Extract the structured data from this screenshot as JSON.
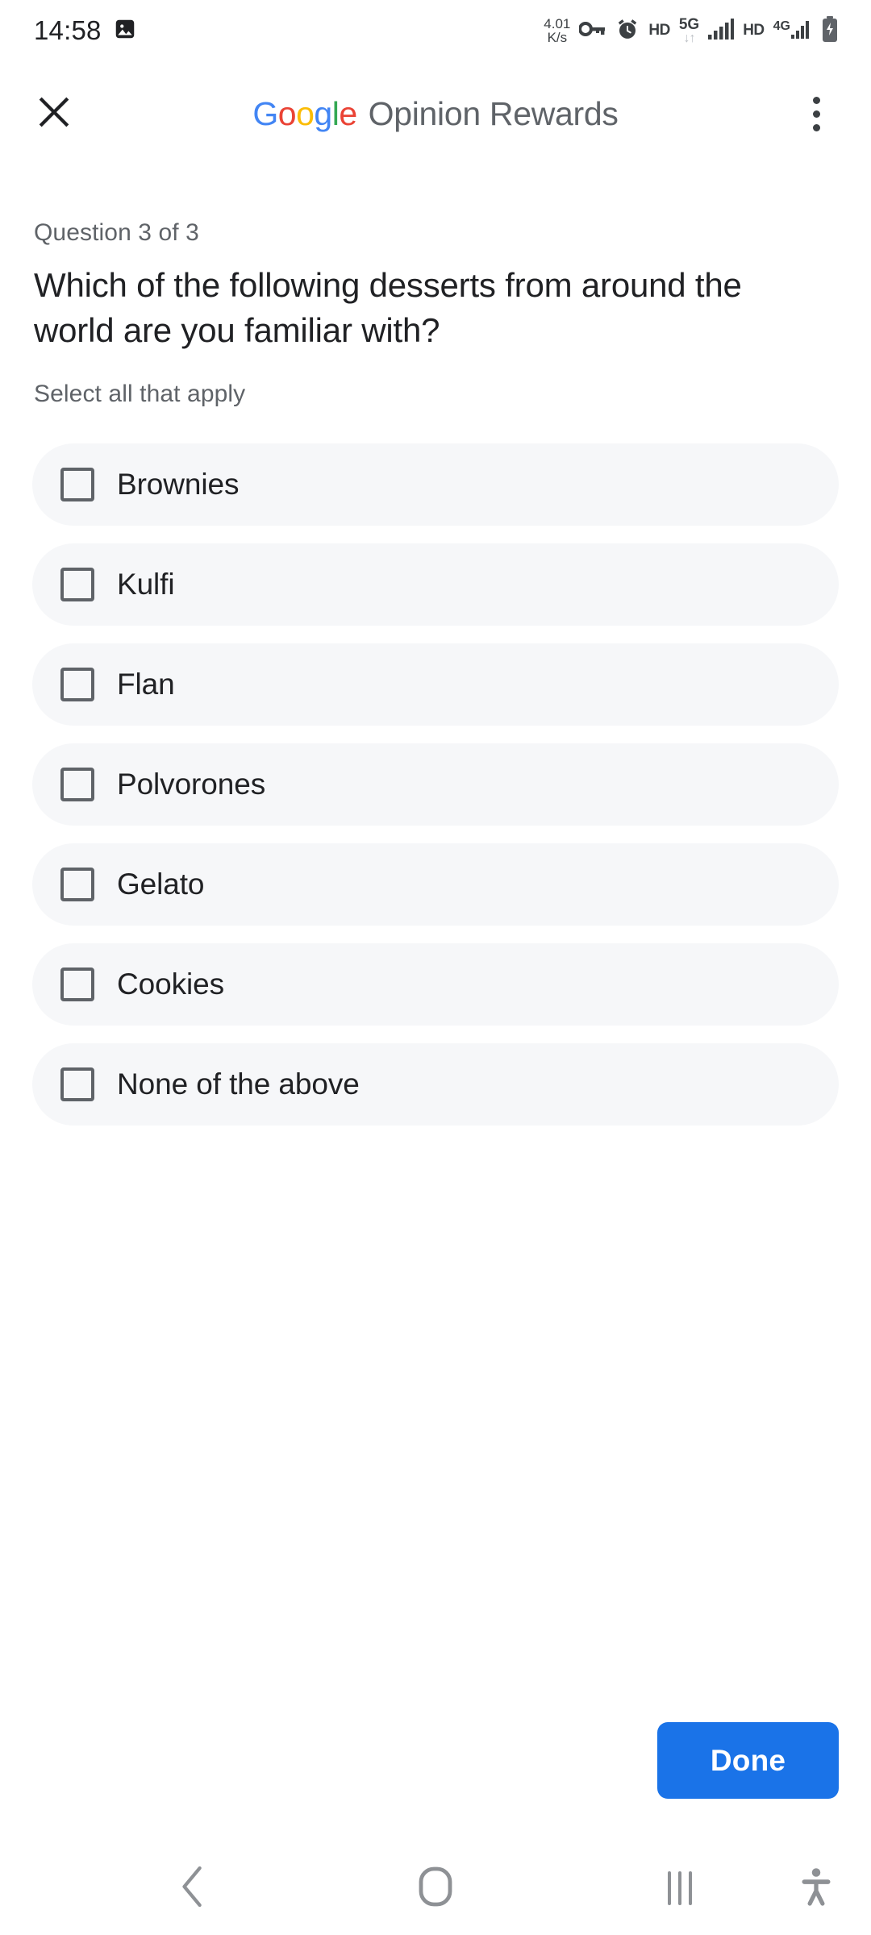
{
  "status_bar": {
    "time": "14:58",
    "left_icons": [
      "image-icon"
    ],
    "network_speed_value": "4.01",
    "network_speed_unit": "K/s",
    "icons": [
      "vpn-key-icon",
      "alarm-icon"
    ],
    "hd_badge_1": "HD",
    "network_gen_1": "5G",
    "data_arrows": "↓↑",
    "hd_badge_2": "HD",
    "network_gen_2": "4G",
    "battery": "battery-charging-icon"
  },
  "app_bar": {
    "close_icon": "close-icon",
    "brand": {
      "letters": [
        "G",
        "o",
        "o",
        "g",
        "l",
        "e"
      ],
      "colors": [
        "#4285F4",
        "#EA4335",
        "#FBBC05",
        "#4285F4",
        "#34A853",
        "#EA4335"
      ],
      "text": "Google"
    },
    "title": "Opinion Rewards",
    "overflow_icon": "more-vert-icon"
  },
  "survey": {
    "counter": "Question 3 of 3",
    "question": "Which of the following desserts from around the world are you familiar with?",
    "hint": "Select all that apply",
    "options": [
      {
        "label": "Brownies",
        "checked": false
      },
      {
        "label": "Kulfi",
        "checked": false
      },
      {
        "label": "Flan",
        "checked": false
      },
      {
        "label": "Polvorones",
        "checked": false
      },
      {
        "label": "Gelato",
        "checked": false
      },
      {
        "label": "Cookies",
        "checked": false
      },
      {
        "label": "None of the above",
        "checked": false
      }
    ],
    "submit_label": "Done",
    "submit_color": "#1a73e8"
  },
  "nav_bar": {
    "back": "back-chevron-icon",
    "home": "home-icon",
    "recents": "recents-icon",
    "accessibility": "accessibility-icon"
  }
}
